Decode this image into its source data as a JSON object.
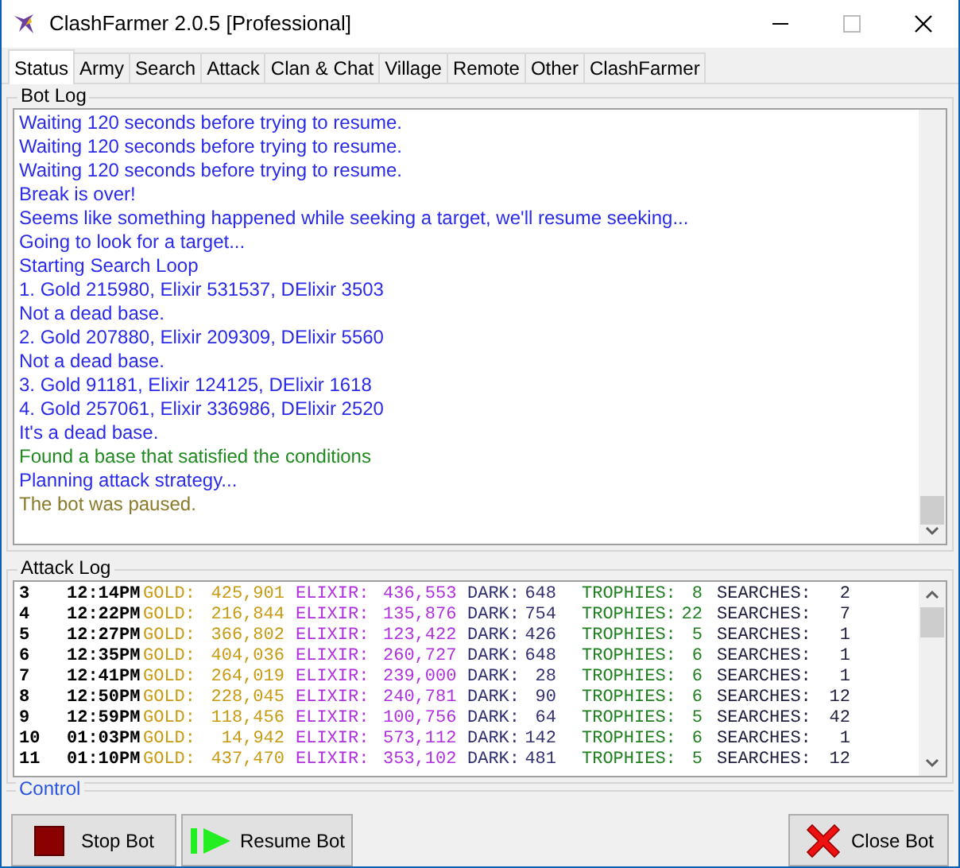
{
  "window": {
    "title": "ClashFarmer 2.0.5 [Professional]"
  },
  "tabs": [
    {
      "label": "Status",
      "selected": true
    },
    {
      "label": "Army",
      "selected": false
    },
    {
      "label": "Search",
      "selected": false
    },
    {
      "label": "Attack",
      "selected": false
    },
    {
      "label": "Clan & Chat",
      "selected": false
    },
    {
      "label": "Village",
      "selected": false
    },
    {
      "label": "Remote",
      "selected": false
    },
    {
      "label": "Other",
      "selected": false
    },
    {
      "label": "ClashFarmer",
      "selected": false
    }
  ],
  "bot_log": {
    "title": "Bot Log",
    "lines": [
      {
        "text": "Waiting 120 seconds before trying to resume.",
        "color": "#2a2ae8"
      },
      {
        "text": "Waiting 120 seconds before trying to resume.",
        "color": "#2a2ae8"
      },
      {
        "text": "Waiting 120 seconds before trying to resume.",
        "color": "#2a2ae8"
      },
      {
        "text": "Break is over!",
        "color": "#2a2ae8"
      },
      {
        "text": "Seems like something happened while seeking a target, we'll resume seeking...",
        "color": "#2a2ae8"
      },
      {
        "text": "Going to look for a target...",
        "color": "#2a2ae8"
      },
      {
        "text": "Starting Search Loop",
        "color": "#2a2ae8"
      },
      {
        "text": "1. Gold 215980, Elixir 531537, DElixir 3503",
        "color": "#2a2ae8"
      },
      {
        "text": "Not a dead base.",
        "color": "#2a2ae8"
      },
      {
        "text": "2. Gold 207880, Elixir 209309, DElixir 5560",
        "color": "#2a2ae8"
      },
      {
        "text": "Not a dead base.",
        "color": "#2a2ae8"
      },
      {
        "text": "3. Gold 91181, Elixir 124125, DElixir 1618",
        "color": "#2a2ae8"
      },
      {
        "text": "4. Gold 257061, Elixir 336986, DElixir 2520",
        "color": "#2a2ae8"
      },
      {
        "text": "It's a dead base.",
        "color": "#2a2ae8"
      },
      {
        "text": "Found a base that satisfied the conditions",
        "color": "#1f8a1f"
      },
      {
        "text": "Planning attack strategy...",
        "color": "#2a2ae8"
      },
      {
        "text": "The bot was paused.",
        "color": "#8a7a2a"
      }
    ]
  },
  "attack_log": {
    "title": "Attack Log",
    "rows": [
      {
        "number": "3",
        "time": "12:14PM",
        "gold_label": "GOLD:",
        "gold": "425,901",
        "elixir_label": "ELIXIR:",
        "elixir": "436,553",
        "dark_label": "DARK:",
        "dark": "648",
        "trophies_label": "TROPHIES:",
        "trophies": "8",
        "searches_label": "SEARCHES:",
        "searches": "2"
      },
      {
        "number": "4",
        "time": "12:22PM",
        "gold_label": "GOLD:",
        "gold": "216,844",
        "elixir_label": "ELIXIR:",
        "elixir": "135,876",
        "dark_label": "DARK:",
        "dark": "754",
        "trophies_label": "TROPHIES:",
        "trophies": "22",
        "searches_label": "SEARCHES:",
        "searches": "7"
      },
      {
        "number": "5",
        "time": "12:27PM",
        "gold_label": "GOLD:",
        "gold": "366,802",
        "elixir_label": "ELIXIR:",
        "elixir": "123,422",
        "dark_label": "DARK:",
        "dark": "426",
        "trophies_label": "TROPHIES:",
        "trophies": "5",
        "searches_label": "SEARCHES:",
        "searches": "1"
      },
      {
        "number": "6",
        "time": "12:35PM",
        "gold_label": "GOLD:",
        "gold": "404,036",
        "elixir_label": "ELIXIR:",
        "elixir": "260,727",
        "dark_label": "DARK:",
        "dark": "648",
        "trophies_label": "TROPHIES:",
        "trophies": "6",
        "searches_label": "SEARCHES:",
        "searches": "1"
      },
      {
        "number": "7",
        "time": "12:41PM",
        "gold_label": "GOLD:",
        "gold": "264,019",
        "elixir_label": "ELIXIR:",
        "elixir": "239,000",
        "dark_label": "DARK:",
        "dark": "28",
        "trophies_label": "TROPHIES:",
        "trophies": "6",
        "searches_label": "SEARCHES:",
        "searches": "1"
      },
      {
        "number": "8",
        "time": "12:50PM",
        "gold_label": "GOLD:",
        "gold": "228,045",
        "elixir_label": "ELIXIR:",
        "elixir": "240,781",
        "dark_label": "DARK:",
        "dark": "90",
        "trophies_label": "TROPHIES:",
        "trophies": "6",
        "searches_label": "SEARCHES:",
        "searches": "12"
      },
      {
        "number": "9",
        "time": "12:59PM",
        "gold_label": "GOLD:",
        "gold": "118,456",
        "elixir_label": "ELIXIR:",
        "elixir": "100,756",
        "dark_label": "DARK:",
        "dark": "64",
        "trophies_label": "TROPHIES:",
        "trophies": "5",
        "searches_label": "SEARCHES:",
        "searches": "42"
      },
      {
        "number": "10",
        "time": "01:03PM",
        "gold_label": "GOLD:",
        "gold": "14,942",
        "elixir_label": "ELIXIR:",
        "elixir": "573,112",
        "dark_label": "DARK:",
        "dark": "142",
        "trophies_label": "TROPHIES:",
        "trophies": "6",
        "searches_label": "SEARCHES:",
        "searches": "1"
      },
      {
        "number": "11",
        "time": "01:10PM",
        "gold_label": "GOLD:",
        "gold": "437,470",
        "elixir_label": "ELIXIR:",
        "elixir": "353,102",
        "dark_label": "DARK:",
        "dark": "481",
        "trophies_label": "TROPHIES:",
        "trophies": "5",
        "searches_label": "SEARCHES:",
        "searches": "12"
      }
    ]
  },
  "control": {
    "title": "Control",
    "buttons": [
      {
        "label": "Stop Bot",
        "kind": "stop"
      },
      {
        "label": "Resume Bot",
        "kind": "resume"
      },
      {
        "label": "Close Bot",
        "kind": "close"
      }
    ]
  }
}
